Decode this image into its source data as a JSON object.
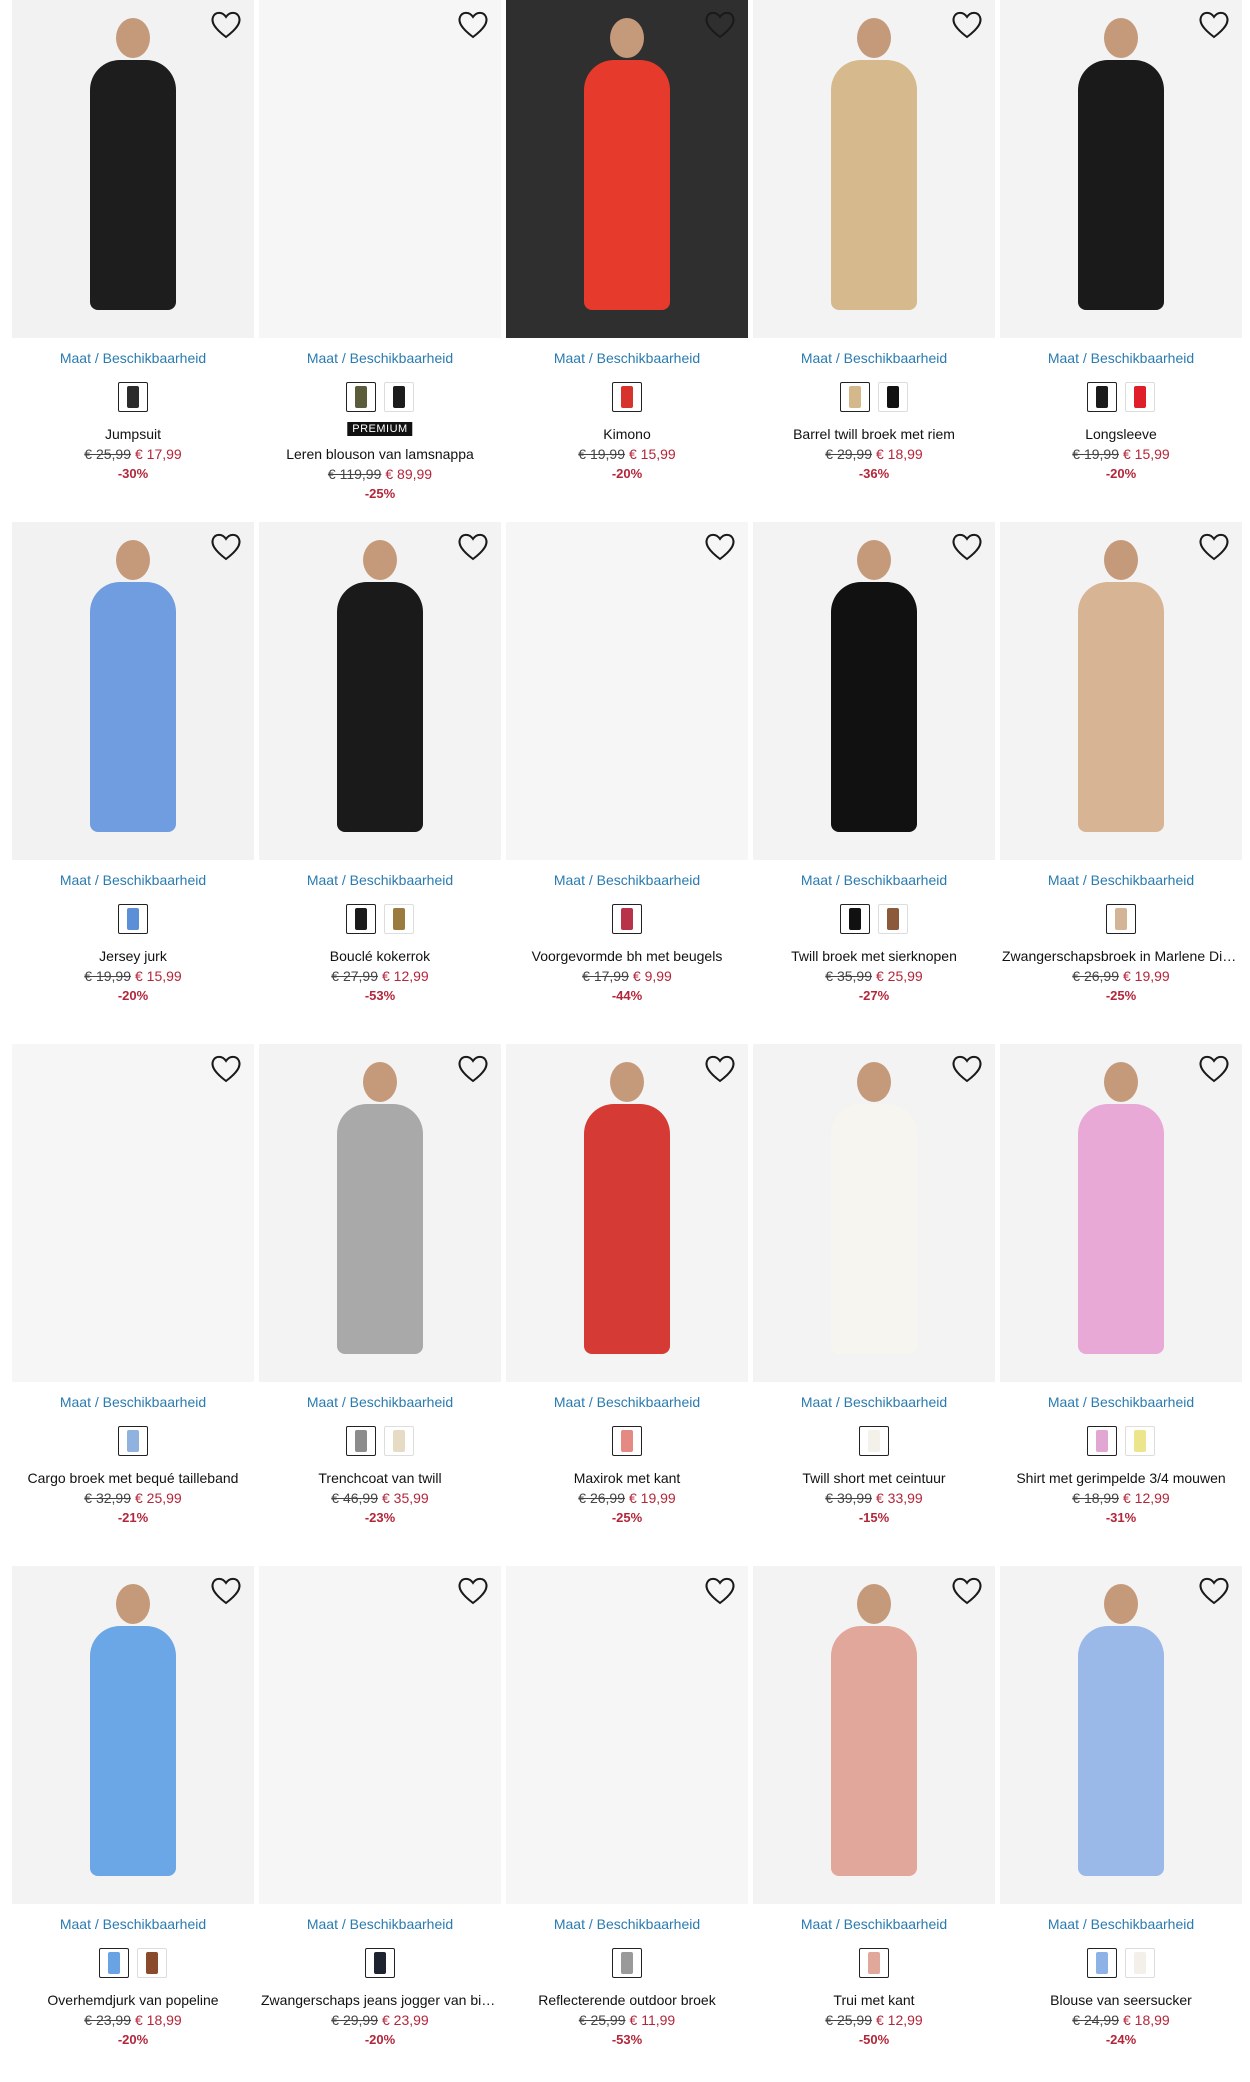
{
  "ui": {
    "maat_label": "Maat / Beschikbaarheid",
    "premium_label": "PREMIUM",
    "heart_icon": "heart-outline-icon"
  },
  "colors": {
    "link": "#2a7bb0",
    "sale": "#b3263a",
    "text": "#111111"
  },
  "products": [
    {
      "name": "Jumpsuit",
      "old_price": "€ 25,99",
      "new_price": "€ 17,99",
      "discount": "-30%",
      "swatches": [
        "#2b2b2b"
      ],
      "img_tone": "#1d1d1d",
      "img_bg": "#f2f2f2"
    },
    {
      "name": "Leren blouson van lamsnappa",
      "old_price": "€ 119,99",
      "new_price": "€ 89,99",
      "discount": "-25%",
      "premium": true,
      "swatches": [
        "#5a5c3a",
        "#1c1c1c"
      ],
      "img_tone": null,
      "img_bg": "#f6f6f6"
    },
    {
      "name": "Kimono",
      "old_price": "€ 19,99",
      "new_price": "€ 15,99",
      "discount": "-20%",
      "swatches": [
        "#d8322c"
      ],
      "img_tone": "#e53a2c",
      "img_bg": "#2f2f2f"
    },
    {
      "name": "Barrel twill broek met riem",
      "old_price": "€ 29,99",
      "new_price": "€ 18,99",
      "discount": "-36%",
      "swatches": [
        "#d4b88c",
        "#111111"
      ],
      "img_tone": "#d6ba8e",
      "img_bg": "#f3f3f3"
    },
    {
      "name": "Longsleeve",
      "old_price": "€ 19,99",
      "new_price": "€ 15,99",
      "discount": "-20%",
      "swatches": [
        "#1a1a1a",
        "#e01e2a"
      ],
      "img_tone": "#1a1a1a",
      "img_bg": "#f3f3f3"
    },
    {
      "name": "Jersey jurk",
      "old_price": "€ 19,99",
      "new_price": "€ 15,99",
      "discount": "-20%",
      "swatches": [
        "#5c8fd6"
      ],
      "img_tone": "#6f9de0",
      "img_bg": "#f2f2f2"
    },
    {
      "name": "Bouclé kokerrok",
      "old_price": "€ 27,99",
      "new_price": "€ 12,99",
      "discount": "-53%",
      "swatches": [
        "#1a1a1a",
        "#9b7a3f"
      ],
      "img_tone": "#1a1a1a",
      "img_bg": "#f3f3f3"
    },
    {
      "name": "Voorgevormde bh met beugels",
      "old_price": "€ 17,99",
      "new_price": "€ 9,99",
      "discount": "-44%",
      "swatches": [
        "#b8334a"
      ],
      "img_tone": null,
      "img_bg": "#f6f6f6"
    },
    {
      "name": "Twill broek met sierknopen",
      "old_price": "€ 35,99",
      "new_price": "€ 25,99",
      "discount": "-27%",
      "swatches": [
        "#111111",
        "#8a5a3a"
      ],
      "img_tone": "#111111",
      "img_bg": "#f3f3f3"
    },
    {
      "name": "Zwangerschapsbroek in Marlene Dietrich-stijl",
      "old_price": "€ 26,99",
      "new_price": "€ 19,99",
      "discount": "-25%",
      "swatches": [
        "#d4b497"
      ],
      "img_tone": "#d7b494",
      "img_bg": "#f3f3f3"
    },
    {
      "name": "Cargo broek met bequé tailleband",
      "old_price": "€ 32,99",
      "new_price": "€ 25,99",
      "discount": "-21%",
      "swatches": [
        "#8fb3de"
      ],
      "img_tone": null,
      "img_bg": "#f6f6f6"
    },
    {
      "name": "Trenchcoat van twill",
      "old_price": "€ 46,99",
      "new_price": "€ 35,99",
      "discount": "-23%",
      "swatches": [
        "#8c8c8c",
        "#e6dcc6"
      ],
      "img_tone": "#a9a9a9",
      "img_bg": "#f3f3f3"
    },
    {
      "name": "Maxirok met kant",
      "old_price": "€ 26,99",
      "new_price": "€ 19,99",
      "discount": "-25%",
      "swatches": [
        "#e58a82"
      ],
      "img_tone": "#d63a34",
      "img_bg": "#f4f4f4"
    },
    {
      "name": "Twill short met ceintuur",
      "old_price": "€ 39,99",
      "new_price": "€ 33,99",
      "discount": "-15%",
      "swatches": [
        "#f3f1ea"
      ],
      "img_tone": "#f7f5f0",
      "img_bg": "#f3f3f3"
    },
    {
      "name": "Shirt met gerimpelde 3/4 mouwen",
      "old_price": "€ 18,99",
      "new_price": "€ 12,99",
      "discount": "-31%",
      "swatches": [
        "#e2a6d2",
        "#ede58c"
      ],
      "img_tone": "#e8a9d6",
      "img_bg": "#f3f3f3"
    },
    {
      "name": "Overhemdjurk van popeline",
      "old_price": "€ 23,99",
      "new_price": "€ 18,99",
      "discount": "-20%",
      "swatches": [
        "#6aa3e3",
        "#8a4a2c"
      ],
      "img_tone": "#6ba6e6",
      "img_bg": "#f3f3f3"
    },
    {
      "name": "Zwangerschaps jeans jogger van biologisch katoen",
      "old_price": "€ 29,99",
      "new_price": "€ 23,99",
      "discount": "-20%",
      "swatches": [
        "#1d2430"
      ],
      "img_tone": null,
      "img_bg": "#f6f6f6"
    },
    {
      "name": "Reflecterende outdoor broek",
      "old_price": "€ 25,99",
      "new_price": "€ 11,99",
      "discount": "-53%",
      "swatches": [
        "#9a9a9a"
      ],
      "img_tone": null,
      "img_bg": "#f6f6f6"
    },
    {
      "name": "Trui met kant",
      "old_price": "€ 25,99",
      "new_price": "€ 12,99",
      "discount": "-50%",
      "swatches": [
        "#e0a89a"
      ],
      "img_tone": "#e2a79b",
      "img_bg": "#f3f3f3"
    },
    {
      "name": "Blouse van seersucker",
      "old_price": "€ 24,99",
      "new_price": "€ 18,99",
      "discount": "-24%",
      "swatches": [
        "#8fb2e6",
        "#f2f0e8"
      ],
      "img_tone": "#9ab8e8",
      "img_bg": "#f3f3f3"
    }
  ]
}
